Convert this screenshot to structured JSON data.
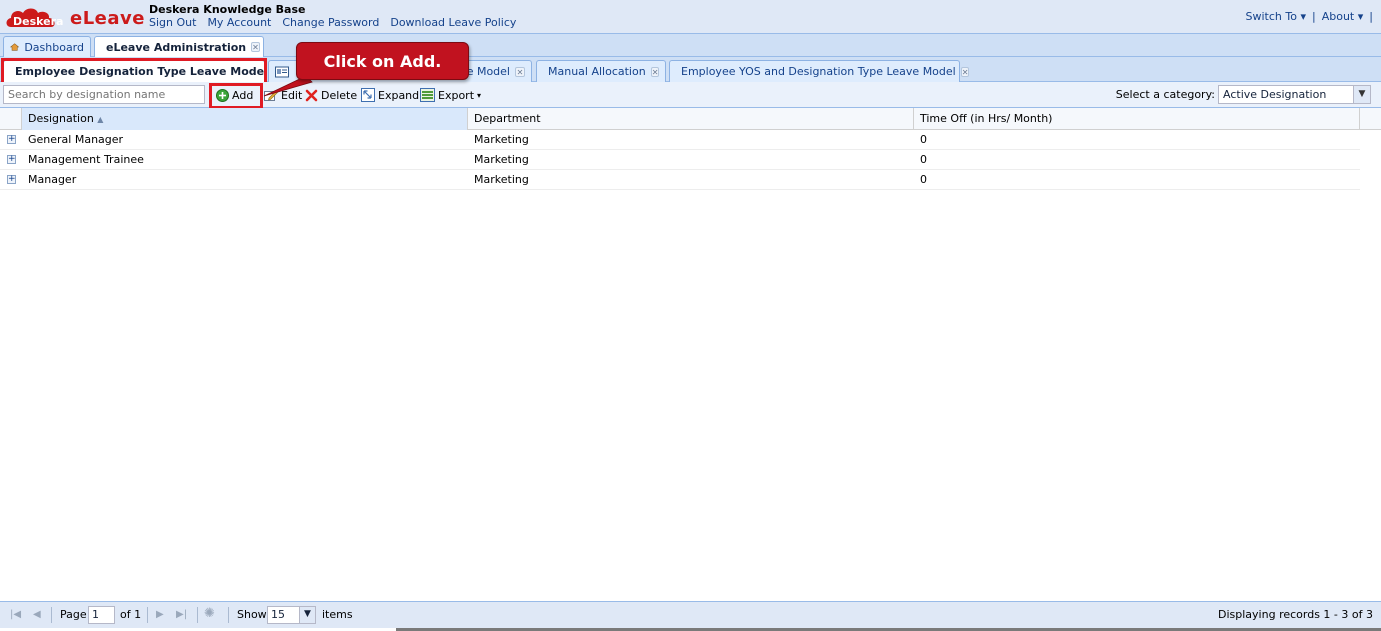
{
  "header": {
    "logo_brand": "Deskera",
    "logo_product": "eLeave",
    "org_name": "Deskera Knowledge Base",
    "links": [
      "Sign Out",
      "My Account",
      "Change Password",
      "Download Leave Policy"
    ],
    "switch_to": "Switch To",
    "about": "About"
  },
  "main_tabs": [
    {
      "label": "Dashboard"
    },
    {
      "label": "eLeave Administration"
    }
  ],
  "sub_tabs": [
    {
      "label": "Employee Designation Type Leave Model"
    },
    {
      "label": "ve Model"
    },
    {
      "label": "Manual Allocation"
    },
    {
      "label": "Employee YOS and Designation Type Leave Model"
    }
  ],
  "callout": "Click on Add.",
  "toolbar": {
    "search_placeholder": "Search by designation name",
    "add": "Add",
    "edit": "Edit",
    "delete": "Delete",
    "expand": "Expand",
    "export": "Export",
    "category_label": "Select a category:",
    "category_value": "Active Designation"
  },
  "grid": {
    "columns": [
      "Designation",
      "Department",
      "Time Off (in Hrs/ Month)"
    ],
    "rows": [
      {
        "designation": "General Manager",
        "department": "Marketing",
        "time_off": "0"
      },
      {
        "designation": "Management Trainee",
        "department": "Marketing",
        "time_off": "0"
      },
      {
        "designation": "Manager",
        "department": "Marketing",
        "time_off": "0"
      }
    ]
  },
  "footer": {
    "page_label": "Page",
    "page_value": "1",
    "of_label": "of 1",
    "show_label": "Show",
    "show_value": "15",
    "items_label": "items",
    "display_info": "Displaying records 1 - 3 of 3"
  },
  "colors": {
    "accent": "#15428b",
    "highlight": "#e01b24",
    "callout": "#c1121f"
  }
}
